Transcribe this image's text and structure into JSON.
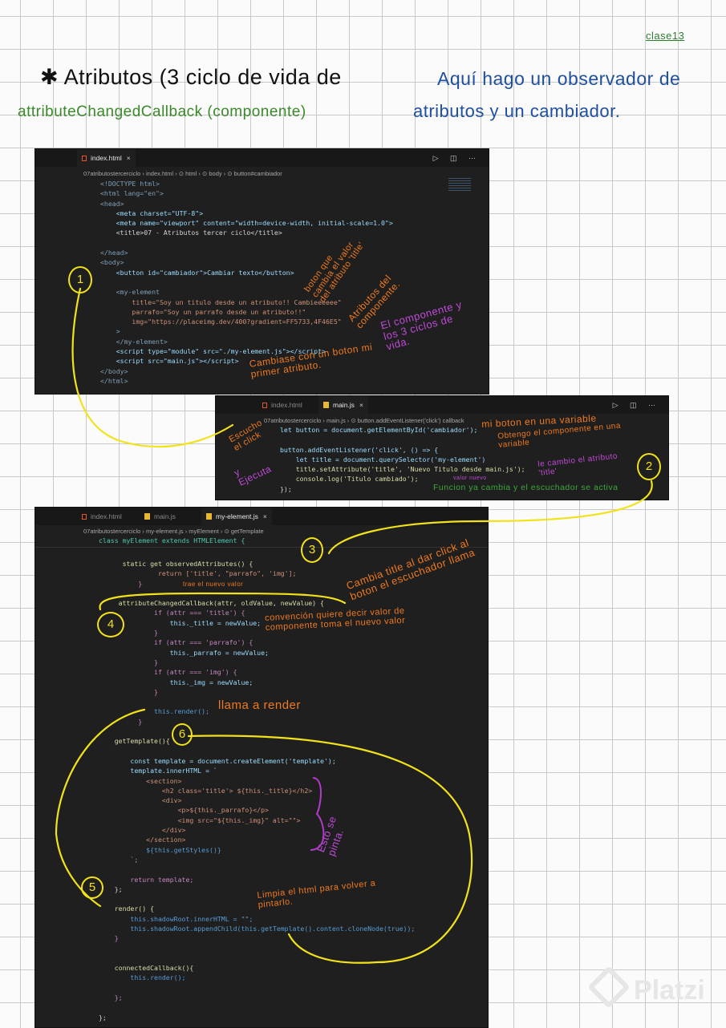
{
  "header": {
    "date_tag": "clase13",
    "title": "✱ Atributos (3 ciclo de vida de",
    "subtitle": "attributeChangedCallback (componente)",
    "note_line1": "Aquí hago un observador de",
    "note_line2": "atributos y un cambiador."
  },
  "colors": {
    "orange": "#f07a1e",
    "purple": "#b03cc8",
    "yellow": "#f2e21a",
    "green": "#3aa83a",
    "blue": "#1f4fa0"
  },
  "panel1": {
    "tabs": [
      {
        "label": "index.html",
        "close": "×"
      }
    ],
    "breadcrumb": "07atributostercerciclo  ›  index.html  ›  ⊙ html  ›  ⊙ body  ›  ⊙ button#cambiador",
    "actions": "▷ ◫ ⋯",
    "lines": [
      {
        "t": "<!DOCTYPE html>",
        "c": "tag"
      },
      {
        "t": "<html lang=\"en\">",
        "c": "tag"
      },
      {
        "t": "<head>",
        "c": "tag"
      },
      {
        "t": "    <meta charset=\"UTF-8\">",
        "c": "attr"
      },
      {
        "t": "    <meta name=\"viewport\" content=\"width=device-width, initial-scale=1.0\">",
        "c": "attr"
      },
      {
        "t": "    <title>07 - Atributos tercer ciclo</title>",
        "c": "plain"
      },
      {
        "t": "",
        "c": "plain"
      },
      {
        "t": "</head>",
        "c": "tag"
      },
      {
        "t": "<body>",
        "c": "tag"
      },
      {
        "t": "    <button id=\"cambiador\">Cambiar texto</button>",
        "c": "attr"
      },
      {
        "t": "",
        "c": "plain"
      },
      {
        "t": "    <my-element",
        "c": "tag"
      },
      {
        "t": "        title=\"Soy un titulo desde un atributo!! Cambieeeeee\"",
        "c": "str"
      },
      {
        "t": "        parrafo=\"Soy un parrafo desde un atributo!!\"",
        "c": "str"
      },
      {
        "t": "        img=\"https://placeimg.dev/400?gradient=FF5733,4F46E5\"",
        "c": "str"
      },
      {
        "t": "    >",
        "c": "tag"
      },
      {
        "t": "    </my-element>",
        "c": "tag"
      },
      {
        "t": "    <script type=\"module\" src=\"./my-element.js\"></script>",
        "c": "attr"
      },
      {
        "t": "    <script src=\"main.js\"></script>",
        "c": "attr"
      },
      {
        "t": "</body>",
        "c": "tag"
      },
      {
        "t": "</html>",
        "c": "tag"
      }
    ]
  },
  "panel2": {
    "tabs": [
      {
        "label": "index.html"
      },
      {
        "label": "main.js",
        "close": "×"
      }
    ],
    "breadcrumb": "07atributostercerciclo  ›  main.js  ›  ⊙ button.addEventListener('click') callback",
    "actions": "▷ ◫ ⋯",
    "lines": [
      {
        "t": "let button = document.getElementById('cambiador');",
        "c": "attr"
      },
      {
        "t": "",
        "c": "plain"
      },
      {
        "t": "button.addEventListener('click', () => {",
        "c": "attr"
      },
      {
        "t": "    let title = document.querySelector('my-element')",
        "c": "attr"
      },
      {
        "t": "    title.setAttribute('title', 'Nuevo Titulo desde main.js');",
        "c": "fn"
      },
      {
        "t": "    console.log('Titulo cambiado');",
        "c": "fn"
      },
      {
        "t": "});",
        "c": "plain"
      }
    ]
  },
  "panel3": {
    "tabs": [
      {
        "label": "index.html"
      },
      {
        "label": "main.js"
      },
      {
        "label": "my-element.js",
        "close": "×"
      }
    ],
    "breadcrumb": "07atributostercerciclo  ›  my-element.js  ›  myElement  ›  ⊙ getTemplate",
    "sticky": "class myElement extends HTMLElement {",
    "lines": [
      {
        "t": "      static get observedAttributes() {",
        "c": "fn"
      },
      {
        "t": "               return ['title', \"parrafo\", 'img'];",
        "c": "str"
      },
      {
        "t": "          }",
        "c": "ctl"
      },
      {
        "t": "",
        "c": "plain"
      },
      {
        "t": "     attributeChangedCallback(attr, oldValue, newValue) {",
        "c": "fn"
      },
      {
        "t": "              if (attr === 'title') {",
        "c": "ctl"
      },
      {
        "t": "                  this._title = newValue;",
        "c": "attr"
      },
      {
        "t": "              }",
        "c": "ctl"
      },
      {
        "t": "              if (attr === 'parrafo') {",
        "c": "ctl"
      },
      {
        "t": "                  this._parrafo = newValue;",
        "c": "attr"
      },
      {
        "t": "              }",
        "c": "ctl"
      },
      {
        "t": "              if (attr === 'img') {",
        "c": "ctl"
      },
      {
        "t": "                  this._img = newValue;",
        "c": "attr"
      },
      {
        "t": "              }",
        "c": "ctl"
      },
      {
        "t": "",
        "c": "plain"
      },
      {
        "t": "              this.render();",
        "c": "kw"
      },
      {
        "t": "          }",
        "c": "ctl"
      },
      {
        "t": "",
        "c": "plain"
      },
      {
        "t": "    getTemplate(){",
        "c": "fn"
      },
      {
        "t": "",
        "c": "plain"
      },
      {
        "t": "        const template = document.createElement('template');",
        "c": "attr"
      },
      {
        "t": "        template.innerHTML = `",
        "c": "attr"
      },
      {
        "t": "            <section>",
        "c": "str"
      },
      {
        "t": "                <h2 class='title'> ${this._title}</h2>",
        "c": "str"
      },
      {
        "t": "                <div>",
        "c": "str"
      },
      {
        "t": "                    <p>${this._parrafo}</p>",
        "c": "str"
      },
      {
        "t": "                    <img src=\"${this._img}\" alt=\"\">",
        "c": "str"
      },
      {
        "t": "                </div>",
        "c": "str"
      },
      {
        "t": "            </section>",
        "c": "str"
      },
      {
        "t": "            ${this.getStyles()}",
        "c": "kw"
      },
      {
        "t": "        `;",
        "c": "str"
      },
      {
        "t": "",
        "c": "plain"
      },
      {
        "t": "        return template;",
        "c": "ctl"
      },
      {
        "t": "    };",
        "c": "plain"
      },
      {
        "t": "",
        "c": "plain"
      },
      {
        "t": "    render() {",
        "c": "fn"
      },
      {
        "t": "        this.shadowRoot.innerHTML = \"\";",
        "c": "kw"
      },
      {
        "t": "        this.shadowRoot.appendChild(this.getTemplate().content.cloneNode(true));",
        "c": "kw"
      },
      {
        "t": "    }",
        "c": "ctl"
      },
      {
        "t": "",
        "c": "plain"
      },
      {
        "t": "",
        "c": "plain"
      },
      {
        "t": "    connectedCallback(){",
        "c": "fn"
      },
      {
        "t": "        this.render();",
        "c": "kw"
      },
      {
        "t": "",
        "c": "plain"
      },
      {
        "t": "    };",
        "c": "ctl"
      },
      {
        "t": "",
        "c": "plain"
      },
      {
        "t": "};",
        "c": "plain"
      }
    ]
  },
  "annotations": {
    "a1": "boton que cambia el valor del atributo 'title'",
    "a2": "Atributos del componente.",
    "a3": "El componente y los 3 ciclos de vida.",
    "a4": "Cambiase con un boton mi primer atributo.",
    "a5": "Escucho el click",
    "a6": "y Ejecuta",
    "a7": "mi boton en una variable",
    "a8": "Obtengo el componente en una variable",
    "a9": "le cambio el atributo 'title'",
    "a10": "valor nuevo",
    "a11": "Funcion ya cambia y el escuchador se activa",
    "a12": "Cambia title al dar click al boton el escuchador llama",
    "a13": "trae el nuevo valor",
    "a14": "convención quiere decir valor de componente toma el nuevo valor",
    "a15": "llama a render",
    "a16": "Esto se pinta.",
    "a17": "Limpia el html para volver a pintarlo."
  },
  "steps": [
    "1",
    "2",
    "3",
    "4",
    "5",
    "6"
  ],
  "watermark": "Platzi"
}
